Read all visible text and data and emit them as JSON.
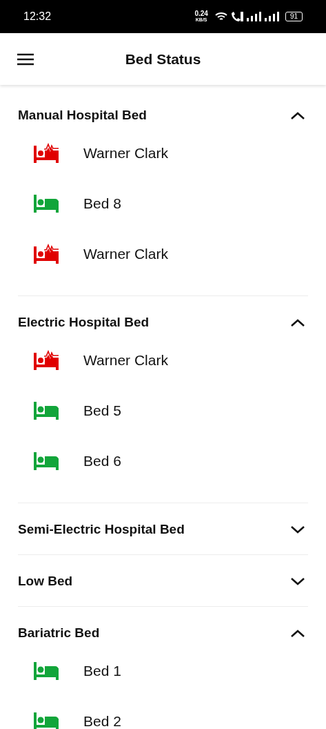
{
  "status_bar": {
    "time": "12:32",
    "speed": "0.24",
    "speed_unit": "KB/S",
    "battery": "91"
  },
  "app_bar": {
    "title": "Bed Status"
  },
  "sections": [
    {
      "title": "Manual Hospital Bed",
      "expanded": true,
      "beds": [
        {
          "name": "Warner Clark",
          "occupied": true
        },
        {
          "name": "Bed 8",
          "occupied": false
        },
        {
          "name": "Warner Clark",
          "occupied": true
        }
      ]
    },
    {
      "title": "Electric Hospital Bed",
      "expanded": true,
      "beds": [
        {
          "name": "Warner Clark",
          "occupied": true
        },
        {
          "name": "Bed 5",
          "occupied": false
        },
        {
          "name": "Bed 6",
          "occupied": false
        }
      ]
    },
    {
      "title": "Semi-Electric Hospital Bed",
      "expanded": false
    },
    {
      "title": "Low Bed",
      "expanded": false
    },
    {
      "title": "Bariatric Bed",
      "expanded": true,
      "beds": [
        {
          "name": "Bed 1",
          "occupied": false
        },
        {
          "name": "Bed 2",
          "occupied": false
        }
      ]
    }
  ]
}
